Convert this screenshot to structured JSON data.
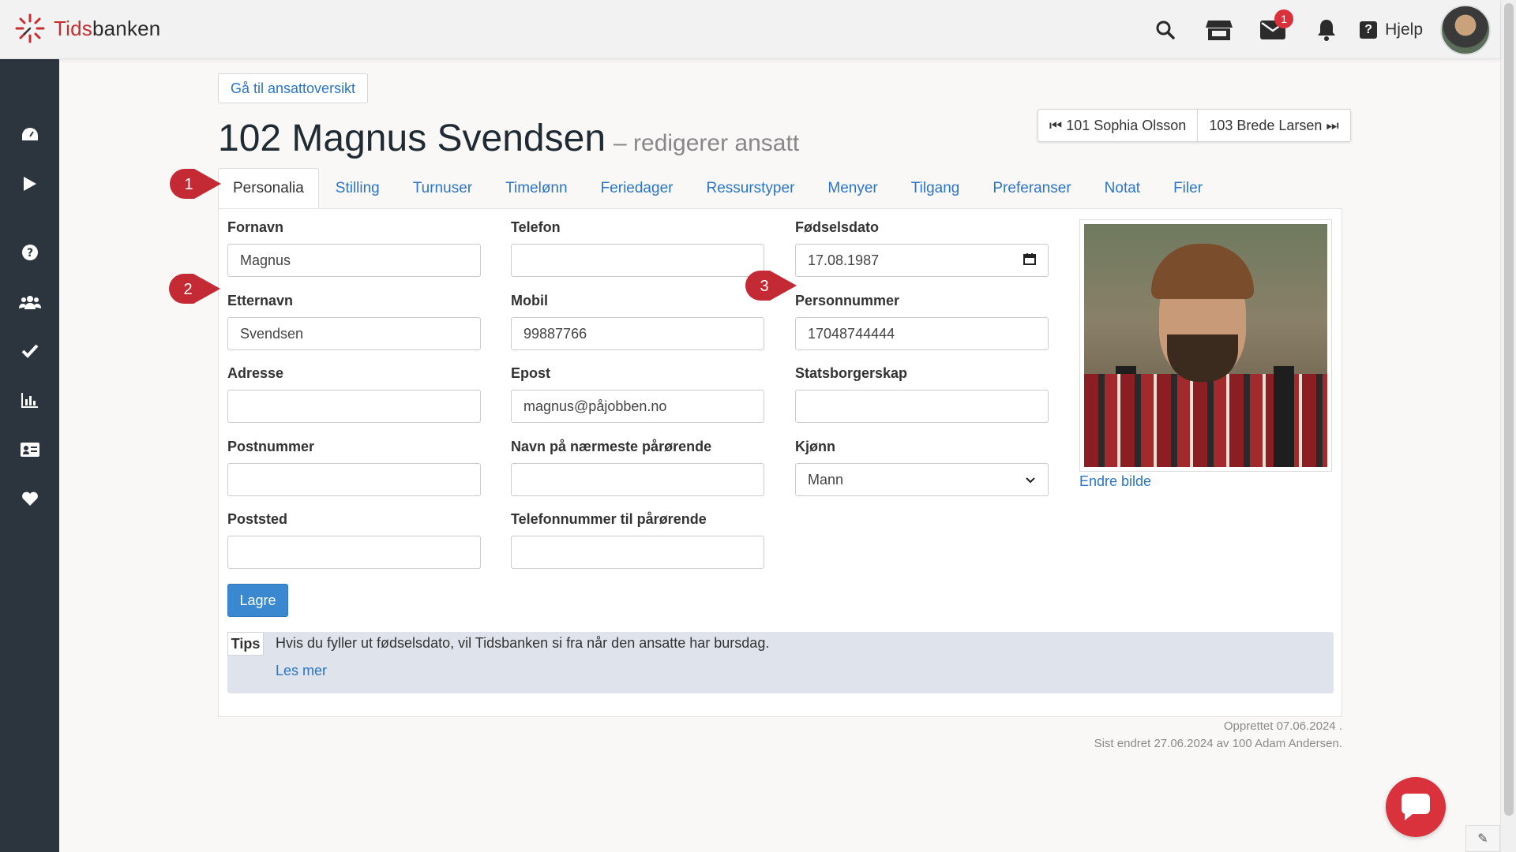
{
  "app": {
    "logo_tids": "Tids",
    "logo_banken": "banken"
  },
  "header": {
    "help_label": "Hjelp",
    "mail_badge": "1",
    "icons": [
      "search-icon",
      "store-icon",
      "envelope-icon",
      "bell-icon",
      "help-icon"
    ]
  },
  "sidebar": {
    "icons": [
      "dashboard-icon",
      "play-icon",
      "question-icon",
      "users-icon",
      "check-icon",
      "chart-icon",
      "id-card-icon",
      "heart-icon"
    ]
  },
  "page": {
    "back_label": "Gå til ansattoversikt",
    "title": "102 Magnus Svendsen",
    "subtitle": "– redigerer ansatt",
    "prev_employee": "101 Sophia Olsson",
    "next_employee": "103 Brede Larsen"
  },
  "tabs": [
    {
      "label": "Personalia",
      "active": true
    },
    {
      "label": "Stilling"
    },
    {
      "label": "Turnuser"
    },
    {
      "label": "Timelønn"
    },
    {
      "label": "Feriedager"
    },
    {
      "label": "Ressurstyper"
    },
    {
      "label": "Menyer"
    },
    {
      "label": "Tilgang"
    },
    {
      "label": "Preferanser"
    },
    {
      "label": "Notat"
    },
    {
      "label": "Filer"
    }
  ],
  "form": {
    "fornavn": {
      "label": "Fornavn",
      "value": "Magnus"
    },
    "etternavn": {
      "label": "Etternavn",
      "value": "Svendsen"
    },
    "adresse": {
      "label": "Adresse",
      "value": ""
    },
    "postnummer": {
      "label": "Postnummer",
      "value": ""
    },
    "poststed": {
      "label": "Poststed",
      "value": ""
    },
    "telefon": {
      "label": "Telefon",
      "value": ""
    },
    "mobil": {
      "label": "Mobil",
      "value": "99887766"
    },
    "epost": {
      "label": "Epost",
      "value": "magnus@påjobben.no"
    },
    "parorende_navn": {
      "label": "Navn på nærmeste pårørende",
      "value": ""
    },
    "parorende_tlf": {
      "label": "Telefonnummer til pårørende",
      "value": ""
    },
    "fodselsdato": {
      "label": "Fødselsdato",
      "value": "17.08.1987"
    },
    "personnummer": {
      "label": "Personnummer",
      "value": "17048744444"
    },
    "statsborgerskap": {
      "label": "Statsborgerskap",
      "value": ""
    },
    "kjonn": {
      "label": "Kjønn",
      "value": "Mann"
    },
    "save_label": "Lagre",
    "change_photo": "Endre bilde"
  },
  "tips": {
    "label": "Tips",
    "text": "Hvis du fyller ut fødselsdato, vil Tidsbanken si fra når den ansatte har bursdag.",
    "link": "Les mer"
  },
  "meta": {
    "created": "Opprettet 07.06.2024 .",
    "modified": "Sist endret 27.06.2024 av 100 Adam Andersen."
  },
  "markers": [
    "1",
    "2",
    "3"
  ],
  "colors": {
    "accent": "#2a75c5",
    "sidebar": "#2c353d",
    "marker": "#c42a34",
    "save": "#3a88cf"
  }
}
